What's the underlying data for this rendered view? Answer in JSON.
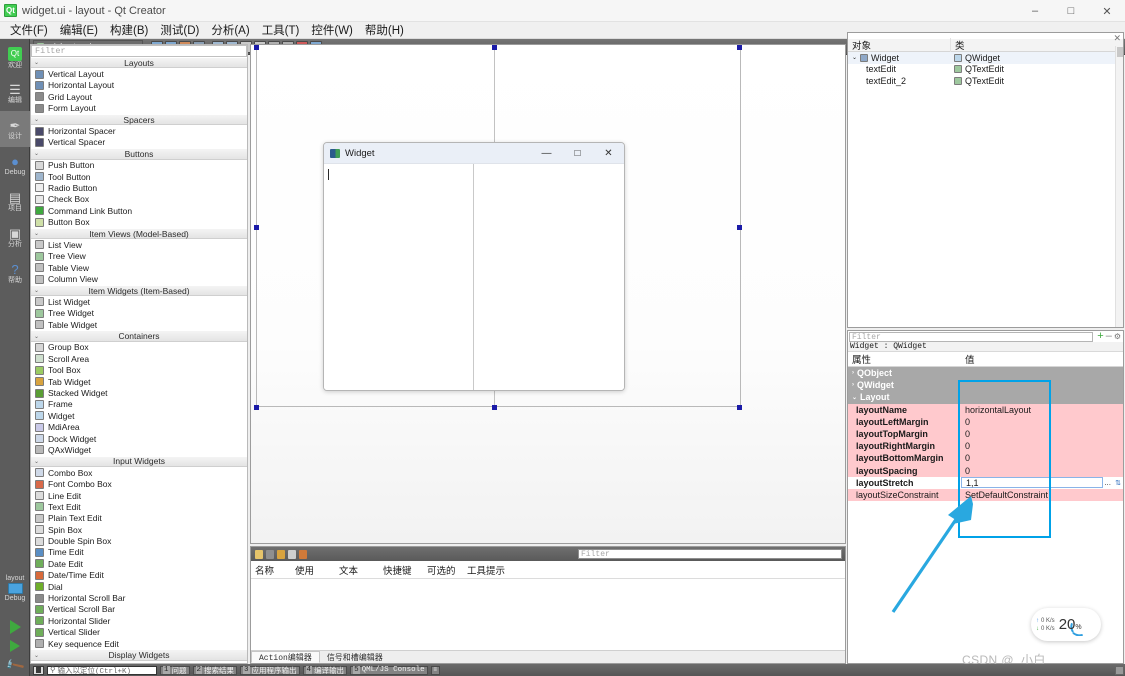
{
  "window": {
    "title": "widget.ui - layout - Qt Creator",
    "logo_glyph": "Qt",
    "minimize": "–",
    "maximize": "□",
    "close": "✕"
  },
  "menubar": {
    "items": [
      {
        "label": "文件(F)",
        "name": "menu-file"
      },
      {
        "label": "编辑(E)",
        "name": "menu-edit"
      },
      {
        "label": "构建(B)",
        "name": "menu-build"
      },
      {
        "label": "测试(D)",
        "name": "menu-debug"
      },
      {
        "label": "分析(A)",
        "name": "menu-analyze"
      },
      {
        "label": "工具(T)",
        "name": "menu-tools"
      },
      {
        "label": "控件(W)",
        "name": "menu-window"
      },
      {
        "label": "帮助(H)",
        "name": "menu-help"
      }
    ]
  },
  "modebar": {
    "items": [
      {
        "label": "欢迎",
        "glyph": "Qt",
        "name": "mode-welcome",
        "active": false
      },
      {
        "label": "编辑",
        "glyph": "☰",
        "name": "mode-edit",
        "active": false
      },
      {
        "label": "设计",
        "glyph": "✒",
        "name": "mode-design",
        "active": true
      },
      {
        "label": "Debug",
        "glyph": "●",
        "name": "mode-debug",
        "active": false
      },
      {
        "label": "项目",
        "glyph": "▤",
        "name": "mode-projects",
        "active": false
      },
      {
        "label": "分析",
        "glyph": "▣",
        "name": "mode-analyze",
        "active": false
      },
      {
        "label": "帮助",
        "glyph": "?",
        "name": "mode-help",
        "active": false
      }
    ],
    "kit_label": "layout",
    "build_config": "Debug"
  },
  "editor_toolbar": {
    "document": "widget.ui",
    "dropdown_caret": "▾",
    "tools": [
      "edit-widgets-icon",
      "edit-signals-slots-icon",
      "edit-buddies-icon",
      "edit-tab-order-icon",
      "layout-horizontally-icon",
      "layout-vertically-icon",
      "layout-splitter-h-icon",
      "layout-splitter-v-icon",
      "layout-form-icon",
      "layout-grid-icon",
      "break-layout-icon",
      "adjust-size-icon"
    ]
  },
  "widget_box": {
    "filter_placeholder": "Filter",
    "groups": [
      {
        "title": "Layouts",
        "items": [
          {
            "label": "Vertical Layout",
            "icon": "vertical-layout-icon",
            "color": "#6f8fb5"
          },
          {
            "label": "Horizontal Layout",
            "icon": "horizontal-layout-icon",
            "color": "#6f8fb5"
          },
          {
            "label": "Grid Layout",
            "icon": "grid-layout-icon",
            "color": "#8a8a8a"
          },
          {
            "label": "Form Layout",
            "icon": "form-layout-icon",
            "color": "#8a8a8a"
          }
        ]
      },
      {
        "title": "Spacers",
        "items": [
          {
            "label": "Horizontal Spacer",
            "icon": "horizontal-spacer-icon",
            "color": "#4a4a6a"
          },
          {
            "label": "Vertical Spacer",
            "icon": "vertical-spacer-icon",
            "color": "#4a4a6a"
          }
        ]
      },
      {
        "title": "Buttons",
        "items": [
          {
            "label": "Push Button",
            "icon": "push-button-icon",
            "color": "#d8d8d8"
          },
          {
            "label": "Tool Button",
            "icon": "tool-button-icon",
            "color": "#9fb6cd"
          },
          {
            "label": "Radio Button",
            "icon": "radio-button-icon",
            "color": "#eeeeee"
          },
          {
            "label": "Check Box",
            "icon": "check-box-icon",
            "color": "#e8e8e8"
          },
          {
            "label": "Command Link Button",
            "icon": "command-link-button-icon",
            "color": "#3fa93f"
          },
          {
            "label": "Button Box",
            "icon": "button-box-icon",
            "color": "#cfe0a8"
          }
        ]
      },
      {
        "title": "Item Views (Model-Based)",
        "items": [
          {
            "label": "List View",
            "icon": "list-view-icon",
            "color": "#c9c9c9"
          },
          {
            "label": "Tree View",
            "icon": "tree-view-icon",
            "color": "#9ec89e"
          },
          {
            "label": "Table View",
            "icon": "table-view-icon",
            "color": "#c0c0c0"
          },
          {
            "label": "Column View",
            "icon": "column-view-icon",
            "color": "#c0c0c0"
          }
        ]
      },
      {
        "title": "Item Widgets (Item-Based)",
        "items": [
          {
            "label": "List Widget",
            "icon": "list-widget-icon",
            "color": "#c9c9c9"
          },
          {
            "label": "Tree Widget",
            "icon": "tree-widget-icon",
            "color": "#9ec89e"
          },
          {
            "label": "Table Widget",
            "icon": "table-widget-icon",
            "color": "#c0c0c0"
          }
        ]
      },
      {
        "title": "Containers",
        "items": [
          {
            "label": "Group Box",
            "icon": "group-box-icon",
            "color": "#d6d6d6"
          },
          {
            "label": "Scroll Area",
            "icon": "scroll-area-icon",
            "color": "#cfe0cf"
          },
          {
            "label": "Tool Box",
            "icon": "tool-box-icon",
            "color": "#9acb63"
          },
          {
            "label": "Tab Widget",
            "icon": "tab-widget-icon",
            "color": "#d8a33f"
          },
          {
            "label": "Stacked Widget",
            "icon": "stacked-widget-icon",
            "color": "#5a9e35"
          },
          {
            "label": "Frame",
            "icon": "frame-icon",
            "color": "#bcd6ea"
          },
          {
            "label": "Widget",
            "icon": "widget-icon",
            "color": "#bcd6ea"
          },
          {
            "label": "MdiArea",
            "icon": "mdi-area-icon",
            "color": "#c9c9e8"
          },
          {
            "label": "Dock Widget",
            "icon": "dock-widget-icon",
            "color": "#cdd8e8"
          },
          {
            "label": "QAxWidget",
            "icon": "qax-widget-icon",
            "color": "#b9b9b9"
          }
        ]
      },
      {
        "title": "Input Widgets",
        "items": [
          {
            "label": "Combo Box",
            "icon": "combo-box-icon",
            "color": "#cfd9e8"
          },
          {
            "label": "Font Combo Box",
            "icon": "font-combo-box-icon",
            "color": "#d96a4a"
          },
          {
            "label": "Line Edit",
            "icon": "line-edit-icon",
            "color": "#dcdcdc"
          },
          {
            "label": "Text Edit",
            "icon": "text-edit-icon",
            "color": "#9ec89e"
          },
          {
            "label": "Plain Text Edit",
            "icon": "plain-text-edit-icon",
            "color": "#c9c9c9"
          },
          {
            "label": "Spin Box",
            "icon": "spin-box-icon",
            "color": "#dcdcdc"
          },
          {
            "label": "Double Spin Box",
            "icon": "double-spin-box-icon",
            "color": "#dcdcdc"
          },
          {
            "label": "Time Edit",
            "icon": "time-edit-icon",
            "color": "#5a8ec4"
          },
          {
            "label": "Date Edit",
            "icon": "date-edit-icon",
            "color": "#6fae5a"
          },
          {
            "label": "Date/Time Edit",
            "icon": "date-time-edit-icon",
            "color": "#d86a3a"
          },
          {
            "label": "Dial",
            "icon": "dial-icon",
            "color": "#6fae2a"
          },
          {
            "label": "Horizontal Scroll Bar",
            "icon": "horizontal-scroll-bar-icon",
            "color": "#8a8a8a"
          },
          {
            "label": "Vertical Scroll Bar",
            "icon": "vertical-scroll-bar-icon",
            "color": "#6fae5a"
          },
          {
            "label": "Horizontal Slider",
            "icon": "horizontal-slider-icon",
            "color": "#6fae5a"
          },
          {
            "label": "Vertical Slider",
            "icon": "vertical-slider-icon",
            "color": "#6fae5a"
          },
          {
            "label": "Key sequence Edit",
            "icon": "key-sequence-edit-icon",
            "color": "#b0b0b0"
          }
        ]
      },
      {
        "title": "Display Widgets",
        "items": []
      }
    ]
  },
  "preview": {
    "title": "Widget",
    "minimize": "—",
    "maximize": "□",
    "close": "✕",
    "left_pane_name": "textEdit",
    "right_pane_name": "textEdit_2"
  },
  "action_editor": {
    "filter_placeholder": "Filter",
    "columns": [
      "名称",
      "使用",
      "文本",
      "快捷键",
      "可选的",
      "工具提示"
    ],
    "rows": [],
    "tabs": [
      {
        "label": "Action编辑器",
        "active": true
      },
      {
        "label": "信号和槽编辑器",
        "active": false
      }
    ]
  },
  "object_inspector": {
    "columns": [
      "对象",
      "类"
    ],
    "close_glyph": "✕",
    "rows": [
      {
        "object": "Widget",
        "class": "QWidget",
        "indent": 0,
        "expander": "⌄",
        "selected": true
      },
      {
        "object": "textEdit",
        "class": "QTextEdit",
        "indent": 1,
        "expander": "",
        "selected": false
      },
      {
        "object": "textEdit_2",
        "class": "QTextEdit",
        "indent": 1,
        "expander": "",
        "selected": false
      }
    ]
  },
  "property_editor": {
    "filter_placeholder": "Filter",
    "object_line": "Widget : QWidget",
    "columns": [
      "属性",
      "值"
    ],
    "add_glyph": "+",
    "remove_glyph": "–",
    "config_glyph": "⚙",
    "groups": [
      {
        "type": "group",
        "label": "QObject",
        "expander": "›"
      },
      {
        "type": "group",
        "label": "QWidget",
        "expander": "›"
      },
      {
        "type": "group",
        "label": "Layout",
        "expander": "⌄"
      }
    ],
    "rows": [
      {
        "key": "layoutName",
        "value": "horizontalLayout",
        "modified": true,
        "bold": true
      },
      {
        "key": "layoutLeftMargin",
        "value": "0",
        "modified": true,
        "bold": true
      },
      {
        "key": "layoutTopMargin",
        "value": "0",
        "modified": true,
        "bold": true
      },
      {
        "key": "layoutRightMargin",
        "value": "0",
        "modified": true,
        "bold": true
      },
      {
        "key": "layoutBottomMargin",
        "value": "0",
        "modified": true,
        "bold": true
      },
      {
        "key": "layoutSpacing",
        "value": "0",
        "modified": true,
        "bold": true
      },
      {
        "key": "layoutStretch",
        "value": "1,1",
        "modified": false,
        "bold": true,
        "editing": true,
        "ellipsis": "..."
      },
      {
        "key": "layoutSizeConstraint",
        "value": "SetDefaultConstraint",
        "modified": true,
        "bold": false
      }
    ]
  },
  "annotation": {
    "highlight_color": "#00a2e8",
    "arrow_color": "#29a8e0"
  },
  "net_speed": {
    "upload": "0  K/s",
    "download": "0  K/s",
    "up_glyph": "↑",
    "down_glyph": "↓",
    "cpu_value": "20",
    "cpu_unit": "%"
  },
  "watermark": {
    "text": "CSDN @_小白__"
  },
  "statusbar": {
    "locator_placeholder": "输入以定位(Ctrl+K)",
    "locator_icon": "⚲",
    "sidebar_toggle": "sidebar-toggle-icon",
    "panes": [
      {
        "num": "1",
        "label": "问题"
      },
      {
        "num": "2",
        "label": "搜索结果"
      },
      {
        "num": "3",
        "label": "应用程序输出"
      },
      {
        "num": "4",
        "label": "编译输出"
      },
      {
        "num": "5",
        "label": "QML/JS Console"
      }
    ],
    "more_glyph": "≡"
  }
}
